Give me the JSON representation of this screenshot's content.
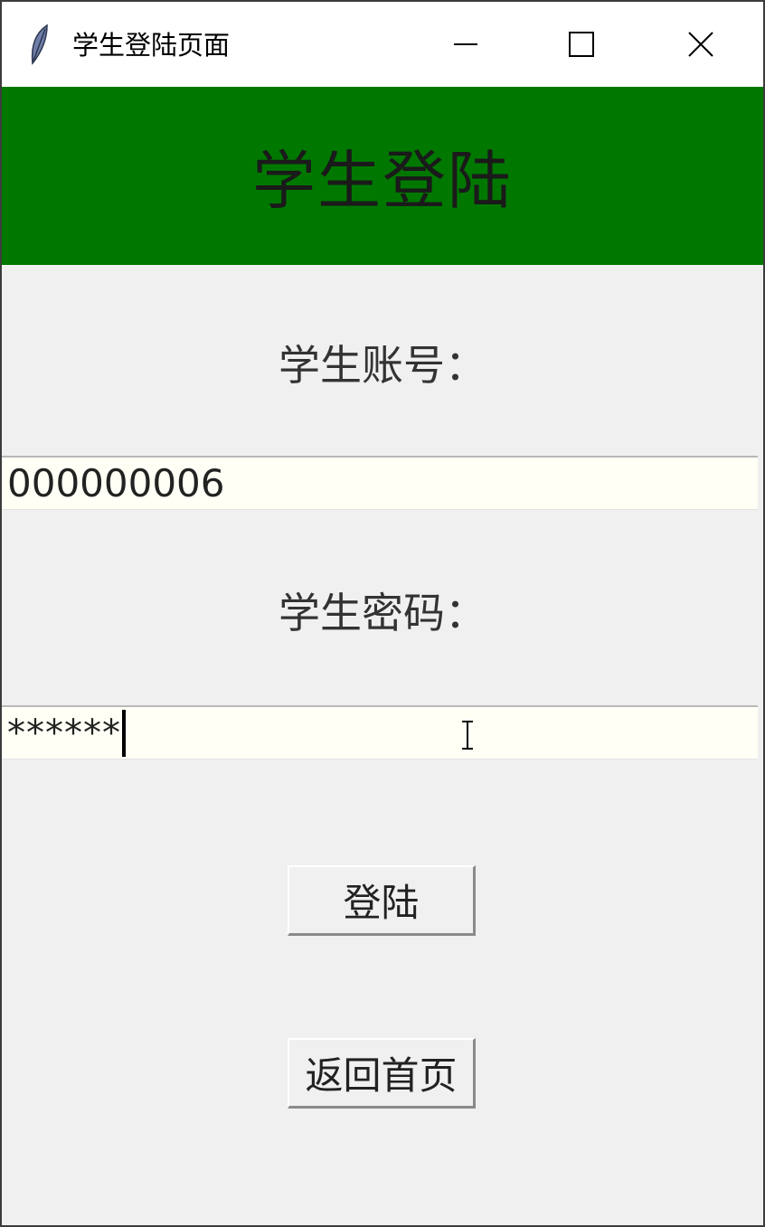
{
  "window": {
    "title": "学生登陆页面",
    "icons": {
      "app": "feather-icon",
      "minimize": "minimize-icon",
      "maximize": "maximize-icon",
      "close": "close-icon"
    }
  },
  "header": {
    "title": "学生登陆",
    "background_color": "#007800"
  },
  "form": {
    "account_label": "学生账号：",
    "account_value": "000000006",
    "password_label": "学生密码：",
    "password_value": "******",
    "field_background": "#fffff6"
  },
  "buttons": {
    "login_label": "登陆",
    "home_label": "返回首页"
  }
}
